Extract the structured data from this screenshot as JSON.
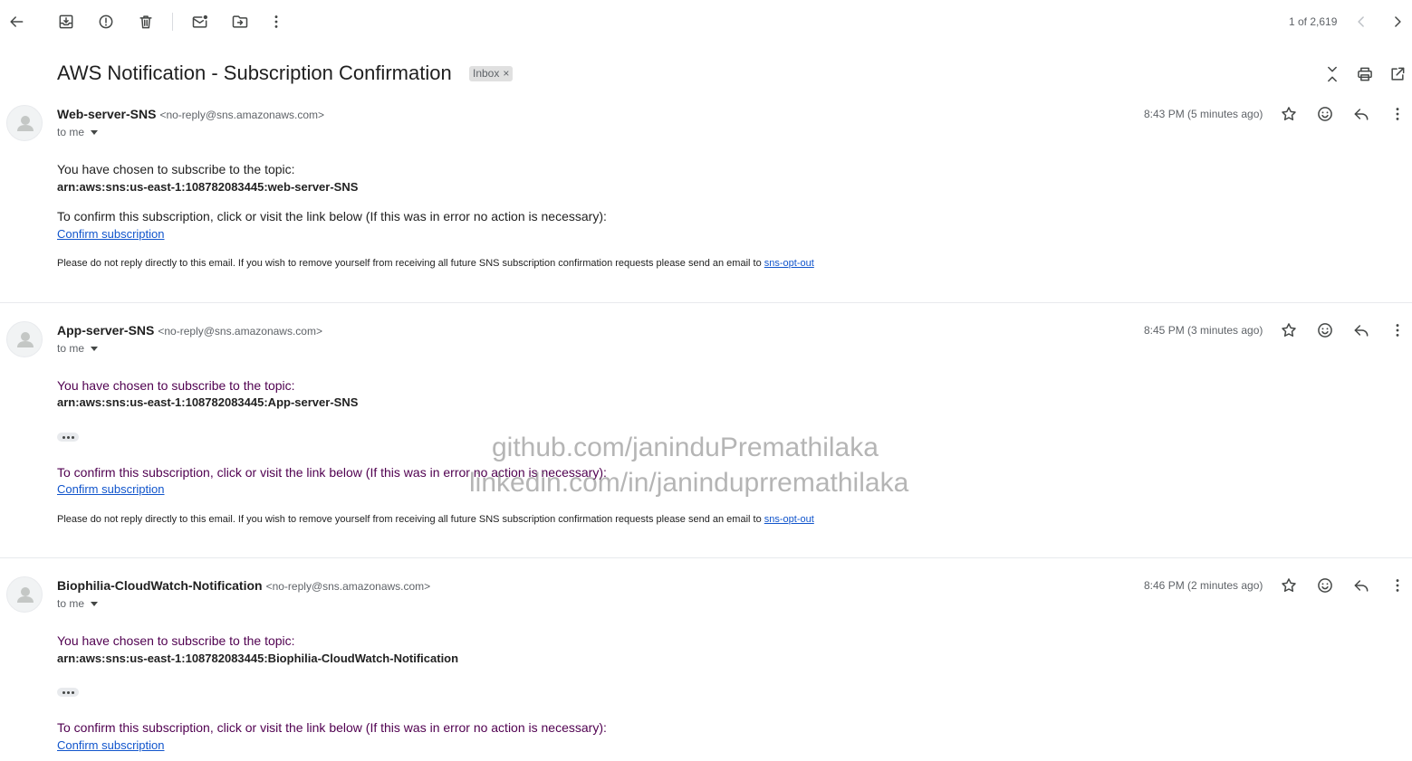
{
  "toolbar": {
    "back_icon": "arrow-left-icon",
    "archive_icon": "archive-icon",
    "spam_icon": "report-spam-icon",
    "delete_icon": "trash-icon",
    "mark_unread_icon": "mark-unread-icon",
    "move_icon": "move-to-icon",
    "more_icon": "more-vert-icon",
    "counter": "1 of 2,619"
  },
  "thread": {
    "subject": "AWS Notification - Subscription Confirmation",
    "label": "Inbox",
    "label_close": "×"
  },
  "messages": [
    {
      "sender_name": "Web-server-SNS",
      "sender_email": "<no-reply@sns.amazonaws.com>",
      "to": "to me",
      "time": "8:43 PM (5 minutes ago)",
      "line1": "You have chosen to subscribe to the topic:",
      "arn": "arn:aws:sns:us-east-1:108782083445:web-server-SNS",
      "line2": "To confirm this subscription, click or visit the link below (If this was in error no action is necessary):",
      "confirm_link": "Confirm subscription",
      "footer": "Please do not reply directly to this email. If you wish to remove yourself from receiving all future SNS subscription confirmation requests please send an email to",
      "opt_out": "sns-opt-out"
    },
    {
      "sender_name": "App-server-SNS",
      "sender_email": "<no-reply@sns.amazonaws.com>",
      "to": "to me",
      "time": "8:45 PM (3 minutes ago)",
      "line1": "You have chosen to subscribe to the topic:",
      "arn": "arn:aws:sns:us-east-1:108782083445:App-server-SNS",
      "line2": "To confirm this subscription, click or visit the link below (If this was in error no action is necessary):",
      "confirm_link": "Confirm subscription",
      "footer": "Please do not reply directly to this email. If you wish to remove yourself from receiving all future SNS subscription confirmation requests please send an email to",
      "opt_out": "sns-opt-out"
    },
    {
      "sender_name": "Biophilia-CloudWatch-Notification",
      "sender_email": "<no-reply@sns.amazonaws.com>",
      "to": "to me",
      "time": "8:46 PM (2 minutes ago)",
      "line1": "You have chosen to subscribe to the topic:",
      "arn": "arn:aws:sns:us-east-1:108782083445:Biophilia-CloudWatch-Notification",
      "line2": "To confirm this subscription, click or visit the link below (If this was in error no action is necessary):",
      "confirm_link": "Confirm subscription"
    }
  ],
  "watermark": {
    "line1": "github.com/janinduPremathilaka",
    "line2": "linkedin.com/in/janinduprremathilaka"
  }
}
